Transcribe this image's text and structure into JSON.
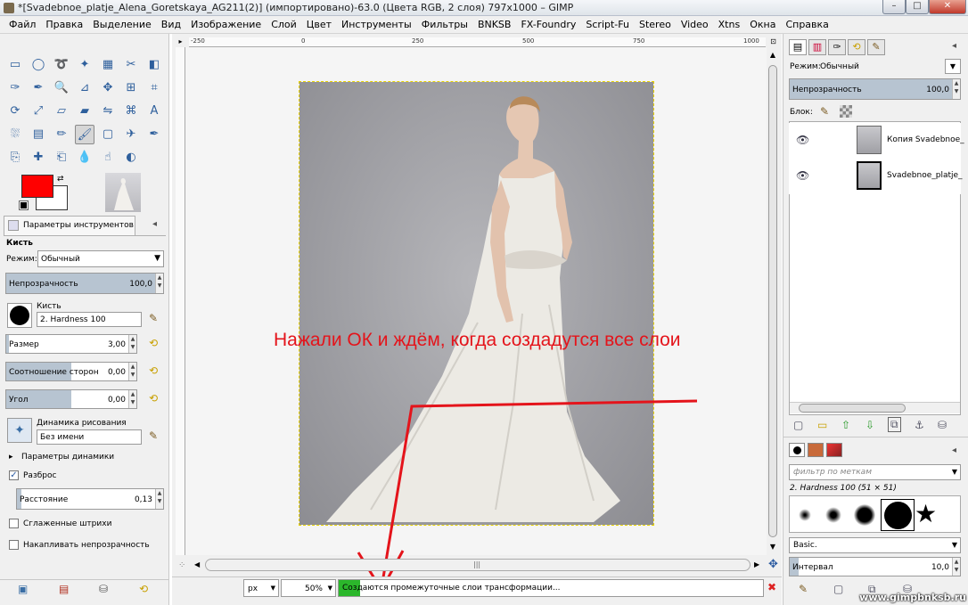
{
  "window": {
    "title": "*[Svadebnoe_platje_Alena_Goretskaya_AG211(2)] (импортировано)-63.0 (Цвета RGB, 2 слоя) 797x1000 – GIMP"
  },
  "menu": [
    "Файл",
    "Правка",
    "Выделение",
    "Вид",
    "Изображение",
    "Слой",
    "Цвет",
    "Инструменты",
    "Фильтры",
    "BNKSB",
    "FX-Foundry",
    "Script-Fu",
    "Stereo",
    "Video",
    "Xtns",
    "Окна",
    "Справка"
  ],
  "toolbox": {
    "tool_icons": [
      "rect-select",
      "ellipse-select",
      "free-select",
      "fuzzy-select",
      "color-select",
      "scissors",
      "foreground-select",
      "paths",
      "color-picker",
      "zoom",
      "measure",
      "move",
      "align",
      "crop",
      "rotate",
      "scale",
      "shear",
      "perspective",
      "flip",
      "cage",
      "text",
      "bucket-fill",
      "blend",
      "pencil",
      "paintbrush",
      "eraser",
      "airbrush",
      "ink",
      "clone",
      "heal",
      "perspective-clone",
      "blur",
      "smudge",
      "dodge-burn"
    ],
    "fg_color": "#ff0000",
    "bg_color": "#ffffff"
  },
  "tool_options": {
    "tab_label": "Параметры инструментов",
    "tool_name": "Кисть",
    "mode_label": "Режим:",
    "mode_value": "Обычный",
    "opacity_label": "Непрозрачность",
    "opacity_value": "100,0",
    "brush_label": "Кисть",
    "brush_value": "2. Hardness 100",
    "size_label": "Размер",
    "size_value": "3,00",
    "aspect_label": "Соотношение сторон",
    "aspect_value": "0,00",
    "angle_label": "Угол",
    "angle_value": "0,00",
    "dynamics_label": "Динамика рисования",
    "dynamics_value": "Без имени",
    "dynamics_options_label": "Параметры динамики",
    "jitter_label": "Разброс",
    "jitter_checked": true,
    "distance_label": "Расстояние",
    "distance_value": "0,13",
    "smooth_label": "Сглаженные штрихи",
    "incremental_label": "Накапливать непрозрачность"
  },
  "canvas": {
    "ruler_marks": [
      "-250",
      "0",
      "250",
      "500",
      "750",
      "1000"
    ],
    "annotation": "Нажали ОК и ждём, когда создадутся все слои",
    "watermark": "www.gimpbnksb.ru"
  },
  "statusbar": {
    "unit": "px",
    "zoom": "50%",
    "message": "Создаются промежуточные слои трансформации...",
    "progress_fraction": 0.05
  },
  "layers": {
    "mode_label": "Режим:",
    "mode_value": "Обычный",
    "opacity_label": "Непрозрачность",
    "opacity_value": "100,0",
    "lock_label": "Блок:",
    "items": [
      {
        "name": "Копия Svadebnoe_"
      },
      {
        "name": "Svadebnoe_platje_"
      }
    ]
  },
  "brushes": {
    "filter_placeholder": "фильтр по меткам",
    "current_brush": "2. Hardness 100 (51 × 51)",
    "preset": "Basic.",
    "spacing_label": "Интервал",
    "spacing_value": "10,0"
  }
}
